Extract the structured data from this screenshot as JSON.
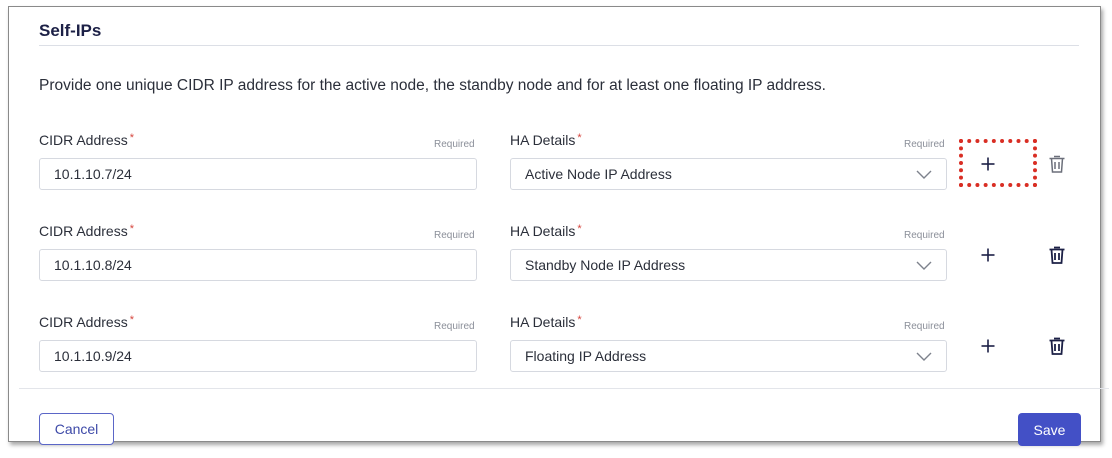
{
  "section": {
    "title": "Self-IPs",
    "intro": "Provide one unique CIDR IP address for the active node, the standby node and for at least one floating IP address."
  },
  "rows": [
    {
      "cidr_label": "CIDR Address",
      "cidr_required": "Required",
      "cidr_value": "10.1.10.7/24",
      "ha_label": "HA Details",
      "ha_required": "Required",
      "ha_value": "Active Node IP Address",
      "add_icon": "plus-icon",
      "delete_icon": "trash-icon"
    },
    {
      "cidr_label": "CIDR Address",
      "cidr_required": "Required",
      "cidr_value": "10.1.10.8/24",
      "ha_label": "HA Details",
      "ha_required": "Required",
      "ha_value": "Standby Node IP Address",
      "add_icon": "plus-icon",
      "delete_icon": "trash-icon"
    },
    {
      "cidr_label": "CIDR Address",
      "cidr_required": "Required",
      "cidr_value": "10.1.10.9/24",
      "ha_label": "HA Details",
      "ha_required": "Required",
      "ha_value": "Floating IP Address",
      "add_icon": "plus-icon",
      "delete_icon": "trash-icon"
    }
  ],
  "required_marker": "*",
  "footer": {
    "cancel_label": "Cancel",
    "save_label": "Save"
  },
  "colors": {
    "accent": "#4350c6",
    "required_star": "#d6453d",
    "highlight": "#d92e24",
    "title": "#1c2046"
  }
}
